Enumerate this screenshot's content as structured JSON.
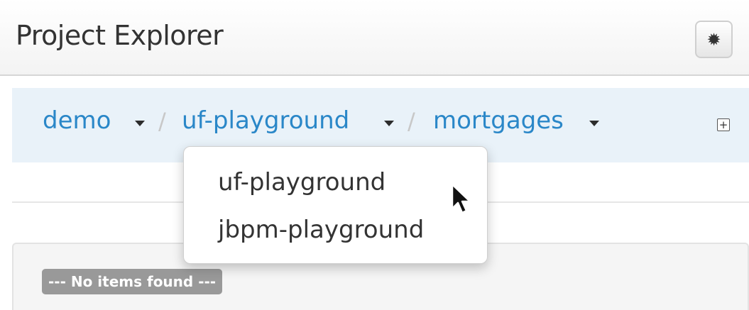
{
  "header": {
    "title": "Project Explorer",
    "settings_icon": "gear-icon"
  },
  "breadcrumb": {
    "items": [
      {
        "label": "demo"
      },
      {
        "label": "uf-playground"
      },
      {
        "label": "mortgages"
      }
    ],
    "separator": "/",
    "expand_icon": "plus-square-icon"
  },
  "dropdown": {
    "items": [
      {
        "label": "uf-playground"
      },
      {
        "label": "jbpm-playground"
      }
    ]
  },
  "items": {
    "empty_label": "--- No items found ---"
  },
  "cursor_icon": "arrow-cursor-icon"
}
